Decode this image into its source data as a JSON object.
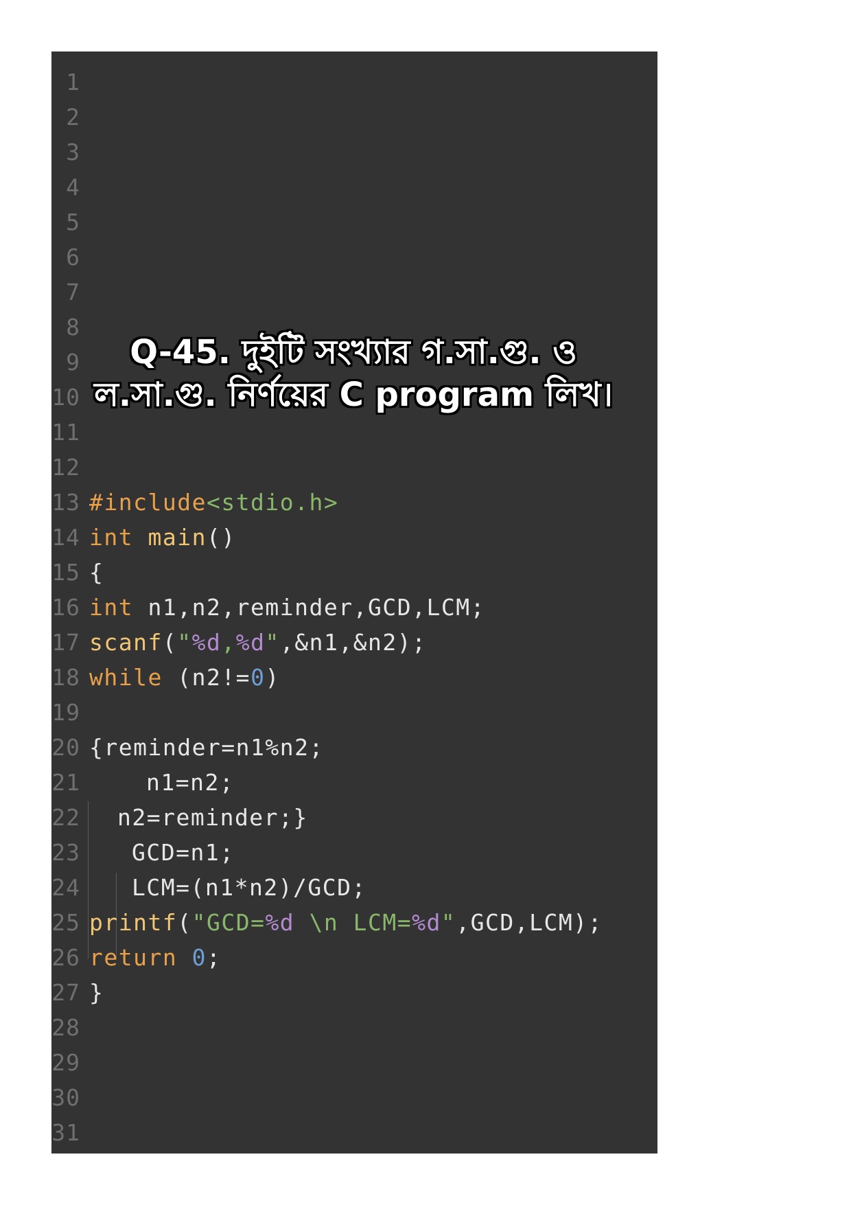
{
  "editor": {
    "line_numbers": [
      "1",
      "2",
      "3",
      "4",
      "5",
      "6",
      "7",
      "8",
      "9",
      "10",
      "11",
      "12",
      "13",
      "14",
      "15",
      "16",
      "17",
      "18",
      "19",
      "20",
      "21",
      "22",
      "23",
      "24",
      "25",
      "26",
      "27",
      "28",
      "29",
      "30",
      "31"
    ],
    "overlay_title": {
      "line1": "Q-45. দুইটি সংখ্যার গ.সা.গু. ও",
      "line2": "ল.সা.গু. নির্ণয়ের C program লিখ।"
    },
    "code": {
      "l13": [
        "#include",
        "<stdio.h>"
      ],
      "l14": [
        "int",
        " ",
        "main",
        "()"
      ],
      "l15": [
        "{"
      ],
      "l16": [
        "int",
        " n1,n2,reminder,GCD,LCM;"
      ],
      "l17": [
        "scanf",
        "(",
        "\"",
        "%d",
        ",",
        "%d",
        "\"",
        ",&n1,&n2);"
      ],
      "l18": [
        "while",
        " (n2!=",
        "0",
        ")"
      ],
      "l20": [
        "{reminder=n1%n2;"
      ],
      "l21": [
        "n1=n2;"
      ],
      "l22": [
        "n2=reminder;}"
      ],
      "l23": [
        "GCD=n1;"
      ],
      "l24": [
        "LCM=(n1*n2)/GCD;"
      ],
      "l25": [
        "printf",
        "(",
        "\"GCD=",
        "%d",
        " \\n LCM=",
        "%d",
        "\"",
        ",GCD,LCM);"
      ],
      "l26": [
        "return",
        " ",
        "0",
        ";"
      ],
      "l27": [
        "}"
      ]
    },
    "colors": {
      "background": "#333333",
      "line_number": "#6f6f6f",
      "text": "#e7e7e7",
      "keyword": "#e8a14a",
      "function": "#f0c674",
      "string": "#8ab86b",
      "format_specifier": "#b48bd1",
      "number": "#6b9fd6"
    }
  }
}
